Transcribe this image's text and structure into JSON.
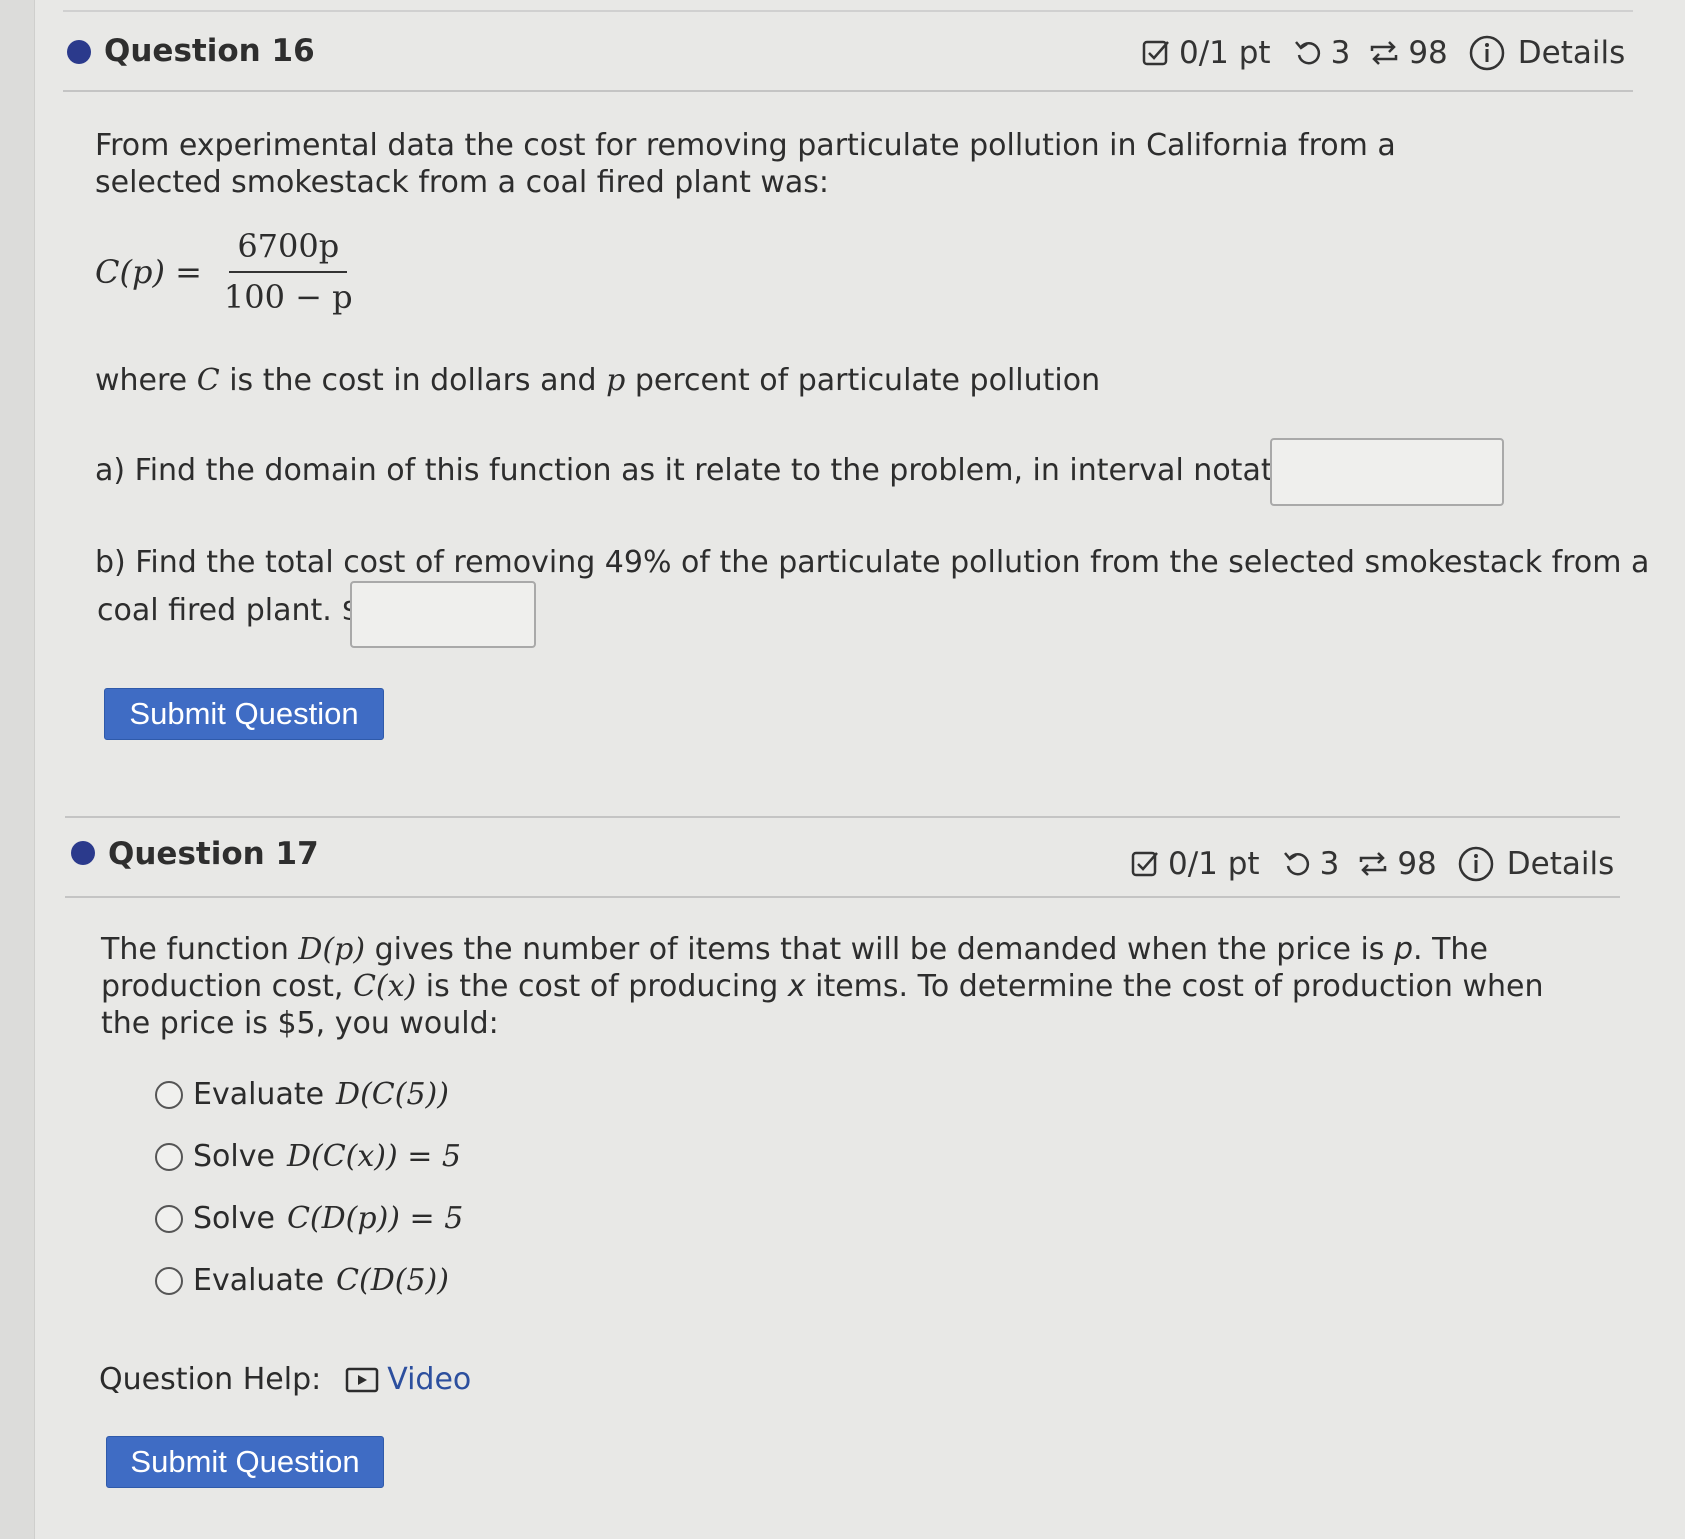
{
  "questions": [
    {
      "title": "Question 16",
      "meta": {
        "score": "0/1 pt",
        "retries": "3",
        "attempts": "98",
        "details": "Details"
      },
      "intro": "From experimental data the cost for removing particulate pollution in California from a selected smokestack from a coal fired plant was:",
      "formula": {
        "lhs": "C(p) =",
        "numerator": "6700p",
        "denominator": "100 − p"
      },
      "where_text": {
        "pre": "where ",
        "var_c": "C",
        "mid": " is the cost in dollars and ",
        "var_p": "p",
        "post": " percent of particulate pollution"
      },
      "part_a": "a) Find the domain of this function as it relate to the problem, in interval notation.",
      "part_a_value": "",
      "part_b_line1": "b) Find the total cost of removing 49% of the particulate pollution from the selected smokestack from a",
      "part_b_line2": "coal fired plant. $",
      "part_b_value": "",
      "submit": "Submit Question"
    },
    {
      "title": "Question 17",
      "meta": {
        "score": "0/1 pt",
        "retries": "3",
        "attempts": "98",
        "details": "Details"
      },
      "body": {
        "s1": "The function ",
        "m1": "D(p)",
        "s2": " gives the number of items that will be demanded when the price is ",
        "m2": "p",
        "s3": ". The production cost, ",
        "m3": "C(x)",
        "s4": " is the cost of producing ",
        "m4": "x",
        "s5": " items. To determine the cost of production when the price is $5, you would:"
      },
      "options": [
        {
          "word": "Evaluate",
          "expr": "D(C(5))"
        },
        {
          "word": "Solve",
          "expr": "D(C(x)) = 5"
        },
        {
          "word": "Solve",
          "expr": "C(D(p)) = 5"
        },
        {
          "word": "Evaluate",
          "expr": "C(D(5))"
        }
      ],
      "help_label": "Question Help:",
      "video_label": "Video",
      "submit": "Submit Question"
    }
  ],
  "colors": {
    "bullet": "#2b3a8c",
    "button": "#3f6cc4",
    "link": "#2c4f9e"
  },
  "icons": [
    "checkbox-icon",
    "retry-icon",
    "attempts-icon",
    "info-icon",
    "video-icon"
  ]
}
